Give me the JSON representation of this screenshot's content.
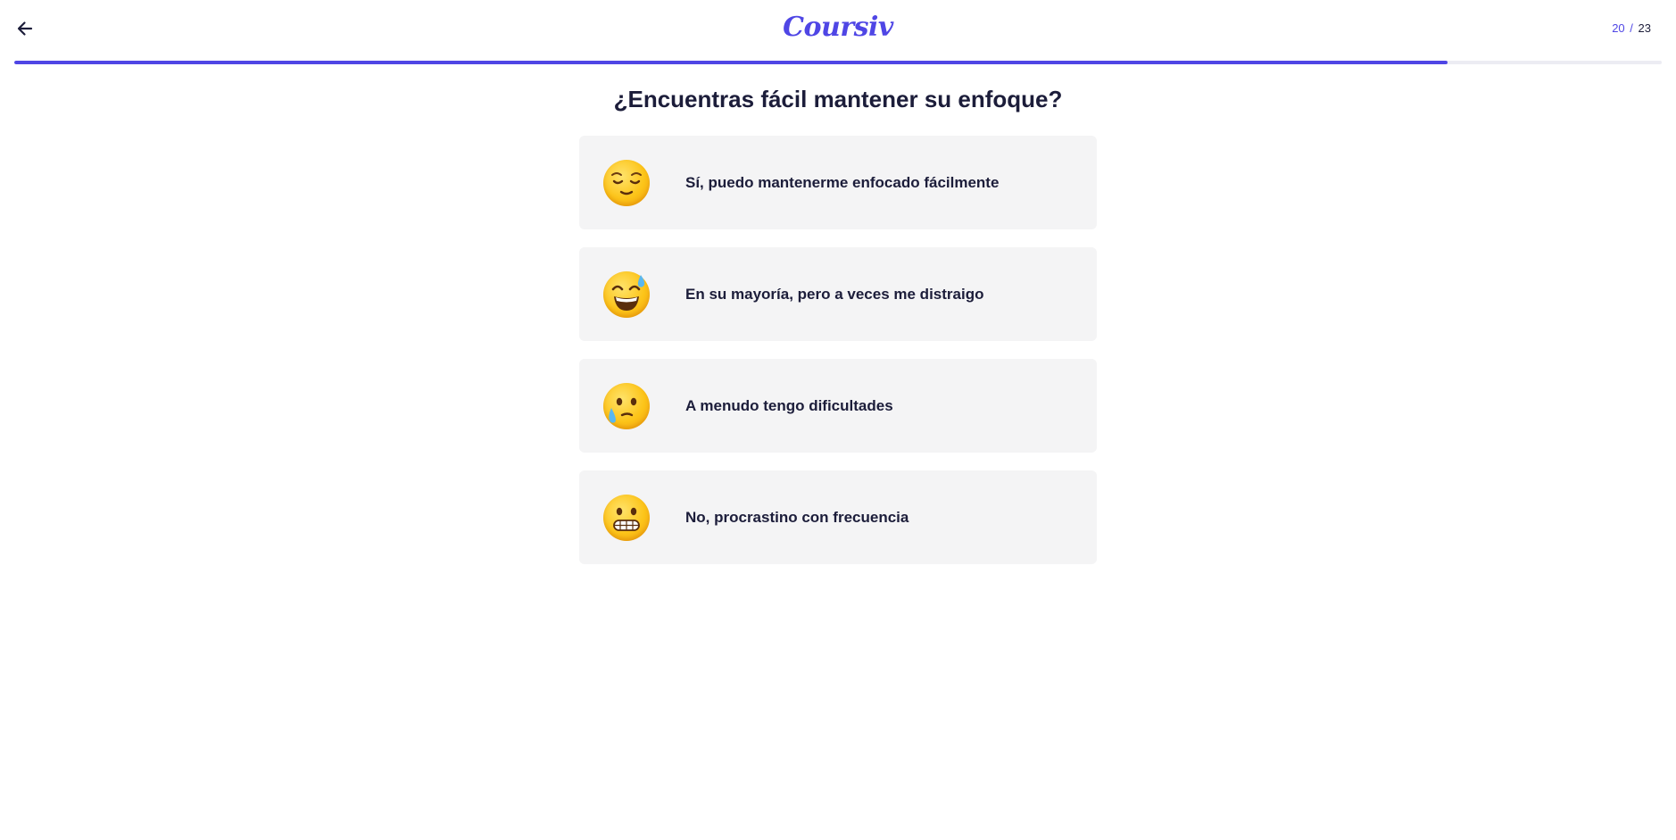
{
  "theme": {
    "accent": "#4f46e5",
    "card": "#f4f4f5",
    "text": "#1c1d3a"
  },
  "header": {
    "back_icon": "arrow-left-icon",
    "logo_text": "Coursiv",
    "step_current": "20",
    "step_separator": "/",
    "step_total": "23"
  },
  "progress": {
    "fraction": 0.87
  },
  "question": "¿Encuentras fácil mantener su enfoque?",
  "options": [
    {
      "icon": "relieved-face-emoji-icon",
      "label": "Sí, puedo mantenerme enfocado fácilmente"
    },
    {
      "icon": "grinning-sweat-face-emoji-icon",
      "label": "En su mayoría, pero a veces me distraigo"
    },
    {
      "icon": "holding-back-tears-face-emoji-icon",
      "label": "A menudo tengo dificultades"
    },
    {
      "icon": "grimacing-face-emoji-icon",
      "label": "No, procrastino con frecuencia"
    }
  ]
}
